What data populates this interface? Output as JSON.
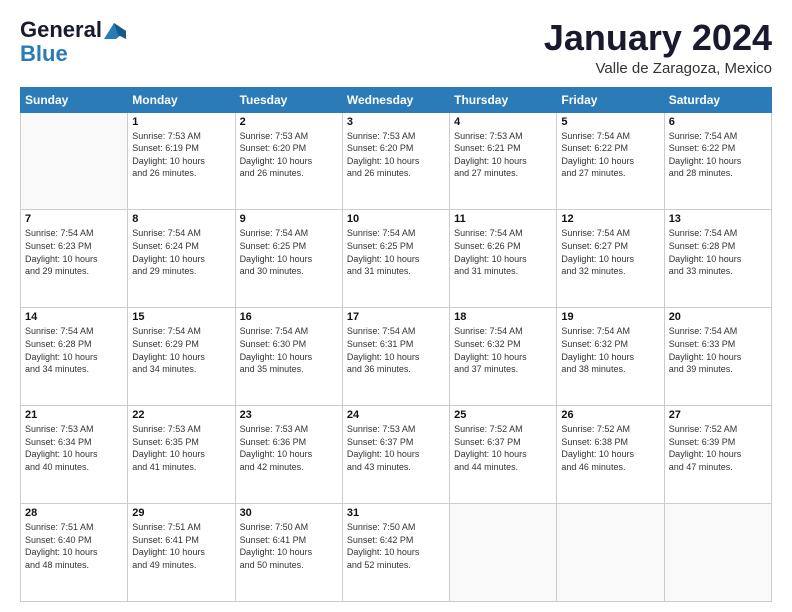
{
  "header": {
    "logo_general": "General",
    "logo_blue": "Blue",
    "month_title": "January 2024",
    "location": "Valle de Zaragoza, Mexico"
  },
  "days_of_week": [
    "Sunday",
    "Monday",
    "Tuesday",
    "Wednesday",
    "Thursday",
    "Friday",
    "Saturday"
  ],
  "weeks": [
    [
      {
        "day": "",
        "info": ""
      },
      {
        "day": "1",
        "info": "Sunrise: 7:53 AM\nSunset: 6:19 PM\nDaylight: 10 hours\nand 26 minutes."
      },
      {
        "day": "2",
        "info": "Sunrise: 7:53 AM\nSunset: 6:20 PM\nDaylight: 10 hours\nand 26 minutes."
      },
      {
        "day": "3",
        "info": "Sunrise: 7:53 AM\nSunset: 6:20 PM\nDaylight: 10 hours\nand 26 minutes."
      },
      {
        "day": "4",
        "info": "Sunrise: 7:53 AM\nSunset: 6:21 PM\nDaylight: 10 hours\nand 27 minutes."
      },
      {
        "day": "5",
        "info": "Sunrise: 7:54 AM\nSunset: 6:22 PM\nDaylight: 10 hours\nand 27 minutes."
      },
      {
        "day": "6",
        "info": "Sunrise: 7:54 AM\nSunset: 6:22 PM\nDaylight: 10 hours\nand 28 minutes."
      }
    ],
    [
      {
        "day": "7",
        "info": "Sunrise: 7:54 AM\nSunset: 6:23 PM\nDaylight: 10 hours\nand 29 minutes."
      },
      {
        "day": "8",
        "info": "Sunrise: 7:54 AM\nSunset: 6:24 PM\nDaylight: 10 hours\nand 29 minutes."
      },
      {
        "day": "9",
        "info": "Sunrise: 7:54 AM\nSunset: 6:25 PM\nDaylight: 10 hours\nand 30 minutes."
      },
      {
        "day": "10",
        "info": "Sunrise: 7:54 AM\nSunset: 6:25 PM\nDaylight: 10 hours\nand 31 minutes."
      },
      {
        "day": "11",
        "info": "Sunrise: 7:54 AM\nSunset: 6:26 PM\nDaylight: 10 hours\nand 31 minutes."
      },
      {
        "day": "12",
        "info": "Sunrise: 7:54 AM\nSunset: 6:27 PM\nDaylight: 10 hours\nand 32 minutes."
      },
      {
        "day": "13",
        "info": "Sunrise: 7:54 AM\nSunset: 6:28 PM\nDaylight: 10 hours\nand 33 minutes."
      }
    ],
    [
      {
        "day": "14",
        "info": "Sunrise: 7:54 AM\nSunset: 6:28 PM\nDaylight: 10 hours\nand 34 minutes."
      },
      {
        "day": "15",
        "info": "Sunrise: 7:54 AM\nSunset: 6:29 PM\nDaylight: 10 hours\nand 34 minutes."
      },
      {
        "day": "16",
        "info": "Sunrise: 7:54 AM\nSunset: 6:30 PM\nDaylight: 10 hours\nand 35 minutes."
      },
      {
        "day": "17",
        "info": "Sunrise: 7:54 AM\nSunset: 6:31 PM\nDaylight: 10 hours\nand 36 minutes."
      },
      {
        "day": "18",
        "info": "Sunrise: 7:54 AM\nSunset: 6:32 PM\nDaylight: 10 hours\nand 37 minutes."
      },
      {
        "day": "19",
        "info": "Sunrise: 7:54 AM\nSunset: 6:32 PM\nDaylight: 10 hours\nand 38 minutes."
      },
      {
        "day": "20",
        "info": "Sunrise: 7:54 AM\nSunset: 6:33 PM\nDaylight: 10 hours\nand 39 minutes."
      }
    ],
    [
      {
        "day": "21",
        "info": "Sunrise: 7:53 AM\nSunset: 6:34 PM\nDaylight: 10 hours\nand 40 minutes."
      },
      {
        "day": "22",
        "info": "Sunrise: 7:53 AM\nSunset: 6:35 PM\nDaylight: 10 hours\nand 41 minutes."
      },
      {
        "day": "23",
        "info": "Sunrise: 7:53 AM\nSunset: 6:36 PM\nDaylight: 10 hours\nand 42 minutes."
      },
      {
        "day": "24",
        "info": "Sunrise: 7:53 AM\nSunset: 6:37 PM\nDaylight: 10 hours\nand 43 minutes."
      },
      {
        "day": "25",
        "info": "Sunrise: 7:52 AM\nSunset: 6:37 PM\nDaylight: 10 hours\nand 44 minutes."
      },
      {
        "day": "26",
        "info": "Sunrise: 7:52 AM\nSunset: 6:38 PM\nDaylight: 10 hours\nand 46 minutes."
      },
      {
        "day": "27",
        "info": "Sunrise: 7:52 AM\nSunset: 6:39 PM\nDaylight: 10 hours\nand 47 minutes."
      }
    ],
    [
      {
        "day": "28",
        "info": "Sunrise: 7:51 AM\nSunset: 6:40 PM\nDaylight: 10 hours\nand 48 minutes."
      },
      {
        "day": "29",
        "info": "Sunrise: 7:51 AM\nSunset: 6:41 PM\nDaylight: 10 hours\nand 49 minutes."
      },
      {
        "day": "30",
        "info": "Sunrise: 7:50 AM\nSunset: 6:41 PM\nDaylight: 10 hours\nand 50 minutes."
      },
      {
        "day": "31",
        "info": "Sunrise: 7:50 AM\nSunset: 6:42 PM\nDaylight: 10 hours\nand 52 minutes."
      },
      {
        "day": "",
        "info": ""
      },
      {
        "day": "",
        "info": ""
      },
      {
        "day": "",
        "info": ""
      }
    ]
  ]
}
